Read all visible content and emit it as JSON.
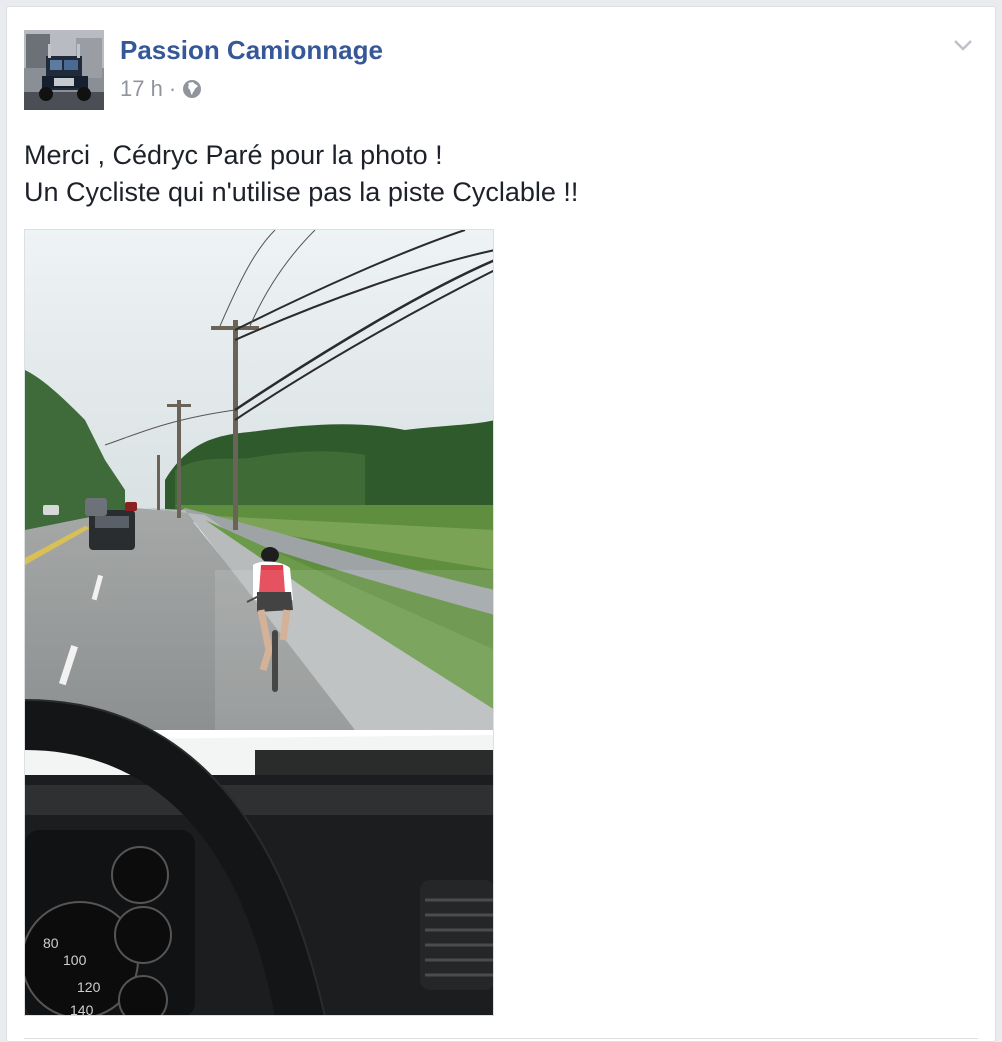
{
  "post": {
    "page_name": "Passion Camionnage",
    "time": "17 h",
    "separator": "·",
    "privacy_icon": "globe-icon",
    "menu_icon": "chevron-down-icon",
    "message_line_1": "Merci , Cédryc Paré pour la photo !",
    "message_line_2": "Un Cycliste qui n'utilise pas la piste Cyclable !!",
    "photo": {
      "icon": "road-photo",
      "speedometer_labels": [
        "80",
        "100",
        "120",
        "140"
      ]
    }
  },
  "colors": {
    "link": "#365899",
    "meta": "#90949c",
    "text": "#1d2129",
    "border": "#dddfe2",
    "background": "#e9ebee"
  }
}
